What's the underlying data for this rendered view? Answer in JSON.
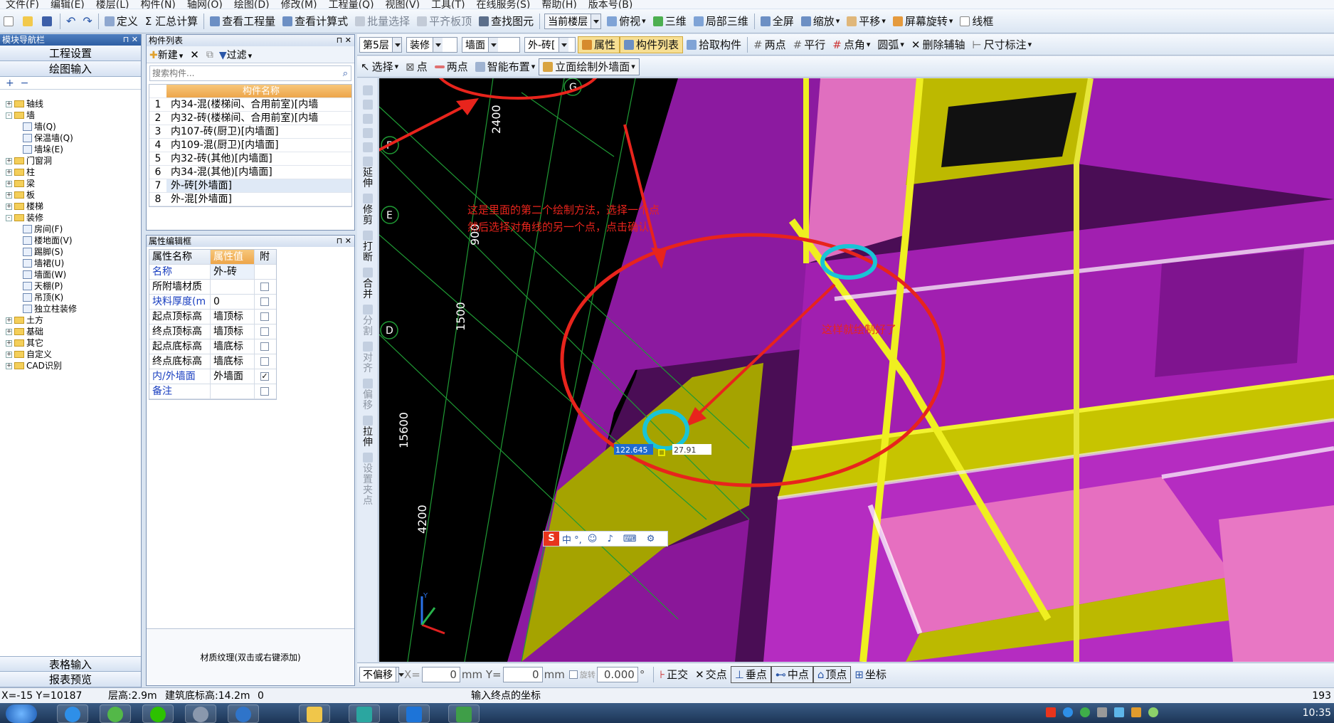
{
  "menu": [
    "文件(F)",
    "编辑(E)",
    "楼层(L)",
    "构件(N)",
    "轴网(O)",
    "绘图(D)",
    "修改(M)",
    "工程量(Q)",
    "视图(V)",
    "工具(T)",
    "在线服务(S)",
    "帮助(H)",
    "版本号(B)"
  ],
  "toolbar1": {
    "define": "定义",
    "sum_calc": "Σ 汇总计算",
    "view_quantity": "查看工程量",
    "view_formula": "查看计算式",
    "batch_select": "批量选择",
    "align_slab": "平齐板顶",
    "find_element": "查找图元",
    "current_floor": "当前楼层",
    "top_view": "俯视",
    "three_d": "三维",
    "partial_3d": "局部三维",
    "fullscreen": "全屏",
    "zoom": "缩放",
    "pan": "平移",
    "screen_rotate": "屏幕旋转",
    "wireframe": "线框"
  },
  "toolbar2": {
    "floor": "第5层",
    "category": "装修",
    "type": "墙面",
    "element": "外-砖[",
    "properties": "属性",
    "component_list": "构件列表",
    "pick_component": "拾取构件",
    "two_points": "两点",
    "parallel": "平行",
    "point_angle": "点角",
    "arc": "圆弧",
    "delete_aux": "删除辅轴",
    "dimension": "尺寸标注"
  },
  "toolbar3": {
    "select": "选择",
    "point": "点",
    "two_points": "两点",
    "smart_layout": "智能布置",
    "elevation_draw": "立面绘制外墙面"
  },
  "nav": {
    "title": "模块导航栏",
    "project_settings": "工程设置",
    "drawing_input": "绘图输入",
    "table_input": "表格输入",
    "report_preview": "报表预览",
    "tree": [
      {
        "label": "轴线",
        "level": 0,
        "type": "folder",
        "exp": "+"
      },
      {
        "label": "墙",
        "level": 0,
        "type": "folder",
        "exp": "-"
      },
      {
        "label": "墙(Q)",
        "level": 1,
        "type": "leaf"
      },
      {
        "label": "保温墙(Q)",
        "level": 1,
        "type": "leaf"
      },
      {
        "label": "墙垛(E)",
        "level": 1,
        "type": "leaf"
      },
      {
        "label": "门窗洞",
        "level": 0,
        "type": "folder",
        "exp": "+"
      },
      {
        "label": "柱",
        "level": 0,
        "type": "folder",
        "exp": "+"
      },
      {
        "label": "梁",
        "level": 0,
        "type": "folder",
        "exp": "+"
      },
      {
        "label": "板",
        "level": 0,
        "type": "folder",
        "exp": "+"
      },
      {
        "label": "楼梯",
        "level": 0,
        "type": "folder",
        "exp": "+"
      },
      {
        "label": "装修",
        "level": 0,
        "type": "folder",
        "exp": "-"
      },
      {
        "label": "房间(F)",
        "level": 1,
        "type": "leaf"
      },
      {
        "label": "楼地面(V)",
        "level": 1,
        "type": "leaf"
      },
      {
        "label": "踢脚(S)",
        "level": 1,
        "type": "leaf"
      },
      {
        "label": "墙裙(U)",
        "level": 1,
        "type": "leaf"
      },
      {
        "label": "墙面(W)",
        "level": 1,
        "type": "leaf"
      },
      {
        "label": "天棚(P)",
        "level": 1,
        "type": "leaf"
      },
      {
        "label": "吊顶(K)",
        "level": 1,
        "type": "leaf"
      },
      {
        "label": "独立柱装修",
        "level": 1,
        "type": "leaf"
      },
      {
        "label": "土方",
        "level": 0,
        "type": "folder",
        "exp": "+"
      },
      {
        "label": "基础",
        "level": 0,
        "type": "folder",
        "exp": "+"
      },
      {
        "label": "其它",
        "level": 0,
        "type": "folder",
        "exp": "+"
      },
      {
        "label": "自定义",
        "level": 0,
        "type": "folder",
        "exp": "+"
      },
      {
        "label": "CAD识别",
        "level": 0,
        "type": "folder",
        "exp": "+"
      }
    ]
  },
  "component_list": {
    "title": "构件列表",
    "new": "新建",
    "filter": "过滤",
    "search_placeholder": "搜索构件...",
    "header": "构件名称",
    "rows": [
      {
        "n": "1",
        "name": "内34-混(楼梯间、合用前室)[内墙"
      },
      {
        "n": "2",
        "name": "内32-砖(楼梯间、合用前室)[内墙"
      },
      {
        "n": "3",
        "name": "内107-砖(厨卫)[内墙面]"
      },
      {
        "n": "4",
        "name": "内109-混(厨卫)[内墙面]"
      },
      {
        "n": "5",
        "name": "内32-砖(其他)[内墙面]"
      },
      {
        "n": "6",
        "name": "内34-混(其他)[内墙面]"
      },
      {
        "n": "7",
        "name": "外-砖[外墙面]"
      },
      {
        "n": "8",
        "name": "外-混[外墙面]"
      }
    ]
  },
  "properties": {
    "title": "属性编辑框",
    "headers": [
      "属性名称",
      "属性值",
      "附"
    ],
    "rows": [
      {
        "k": "名称",
        "v": "外-砖",
        "check": "none",
        "blue": true
      },
      {
        "k": "所附墙材质",
        "v": "",
        "check": "off",
        "blue": false
      },
      {
        "k": "块料厚度(m",
        "v": "0",
        "check": "off",
        "blue": true
      },
      {
        "k": "起点顶标高",
        "v": "墙顶标",
        "check": "off",
        "blue": false
      },
      {
        "k": "终点顶标高",
        "v": "墙顶标",
        "check": "off",
        "blue": false
      },
      {
        "k": "起点底标高",
        "v": "墙底标",
        "check": "off",
        "blue": false
      },
      {
        "k": "终点底标高",
        "v": "墙底标",
        "check": "off",
        "blue": false
      },
      {
        "k": "内/外墙面",
        "v": "外墙面",
        "check": "on",
        "blue": true
      },
      {
        "k": "备注",
        "v": "",
        "check": "off",
        "blue": true
      }
    ],
    "texture_hint": "材质纹理(双击或右键添加)"
  },
  "side_tools": [
    "延伸",
    "修剪",
    "打断",
    "合并",
    "分割",
    "对齐",
    "偏移",
    "拉伸",
    "设置夹点"
  ],
  "viewport": {
    "axis_labels": [
      "G",
      "F",
      "E",
      "D"
    ],
    "dimensions": [
      "2400",
      "900",
      "1500",
      "15600",
      "4200"
    ],
    "annotation1_line1": "这是里面的第二个绘制方法，选择一个点",
    "annotation1_line2": "然后选择对角线的另一个点，点击确认",
    "annotation2": "这样就绘制好了",
    "input_value1": "122.645",
    "input_value2": "27.91",
    "ime_text": "中 °,",
    "colors": {
      "magenta": "#a31fb0",
      "pink": "#e36fbf",
      "yellow": "#c7c400",
      "grid": "#1f9a34",
      "red_mark": "#e8241c",
      "cyan_mark": "#19c4d6"
    }
  },
  "bottom_bar": {
    "mode": "不偏移",
    "x_label": "X=",
    "x_value": "0",
    "unit_x": "mm Y=",
    "y_value": "0",
    "unit_y": "mm",
    "rotate": "旋转",
    "rotate_value": "0.000",
    "degree": "°",
    "ortho": "正交",
    "intersection": "交点",
    "perpendicular": "垂点",
    "midpoint": "中点",
    "vertex": "顶点",
    "coordinate": "坐标"
  },
  "status": {
    "coords": "X=-15 Y=10187",
    "floor_height": "层高:2.9m",
    "base_elev": "建筑底标高:14.2m",
    "zero": "0",
    "prompt": "输入终点的坐标",
    "right_num": "193"
  },
  "taskbar": {
    "clock": "10:35"
  }
}
